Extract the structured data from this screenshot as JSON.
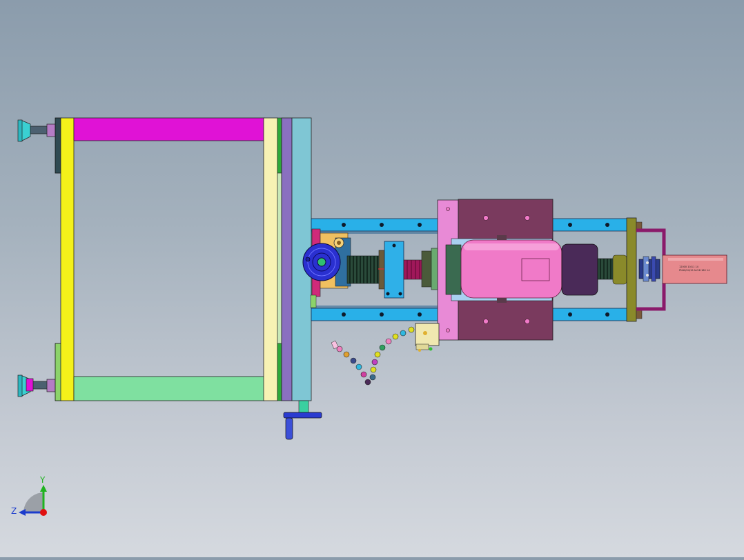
{
  "viewport": {
    "background_top": "#8b9cac",
    "background_bottom": "#d5d9df"
  },
  "triad": {
    "y_label": "Y",
    "z_label": "Z",
    "y_color": "#1fb31f",
    "z_color": "#1c3ccc",
    "x_color": "#e01010"
  },
  "nameplate": {
    "line1": "12000 10/11 14",
    "line2": "PN40/04/19 AU18 180 14"
  },
  "colors": {
    "frame_magenta": "#e012d6",
    "frame_yellow": "#f4f11a",
    "frame_green": "#7fe0a0",
    "rail_blue": "#29b0e8",
    "motor_pink": "#f07ac8",
    "housing_mauve": "#7a3a5e",
    "hand_wheel_blue": "#2a3bd0"
  }
}
